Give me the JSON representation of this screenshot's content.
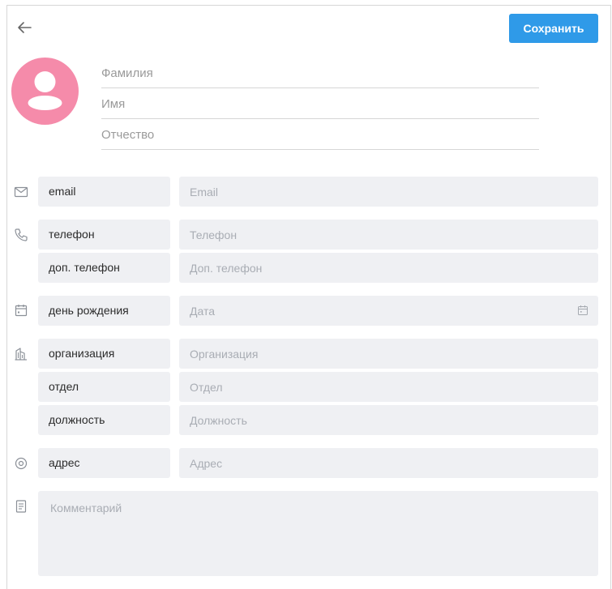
{
  "header": {
    "back_icon": "arrow-left-icon",
    "save_label": "Сохранить",
    "save_color": "#2f9ae8"
  },
  "avatar": {
    "icon": "person-icon",
    "color": "#f58baa"
  },
  "name_fields": {
    "last_name_placeholder": "Фамилия",
    "first_name_placeholder": "Имя",
    "middle_name_placeholder": "Отчество"
  },
  "rows": {
    "email": {
      "icon": "envelope-icon",
      "label": "email",
      "placeholder": "Email"
    },
    "phone": {
      "icon": "phone-icon",
      "label": "телефон",
      "placeholder": "Телефон"
    },
    "extra_phone": {
      "label": "доп. телефон",
      "placeholder": "Доп. телефон"
    },
    "birthday": {
      "icon": "calendar-icon",
      "label": "день рождения",
      "placeholder": "Дата"
    },
    "organization": {
      "icon": "building-icon",
      "label": "организация",
      "placeholder": "Организация"
    },
    "department": {
      "label": "отдел",
      "placeholder": "Отдел"
    },
    "position": {
      "label": "должность",
      "placeholder": "Должность"
    },
    "address": {
      "icon": "location-pin-icon",
      "label": "адрес",
      "placeholder": "Адрес"
    },
    "comment": {
      "icon": "note-icon",
      "placeholder": "Комментарий"
    }
  }
}
